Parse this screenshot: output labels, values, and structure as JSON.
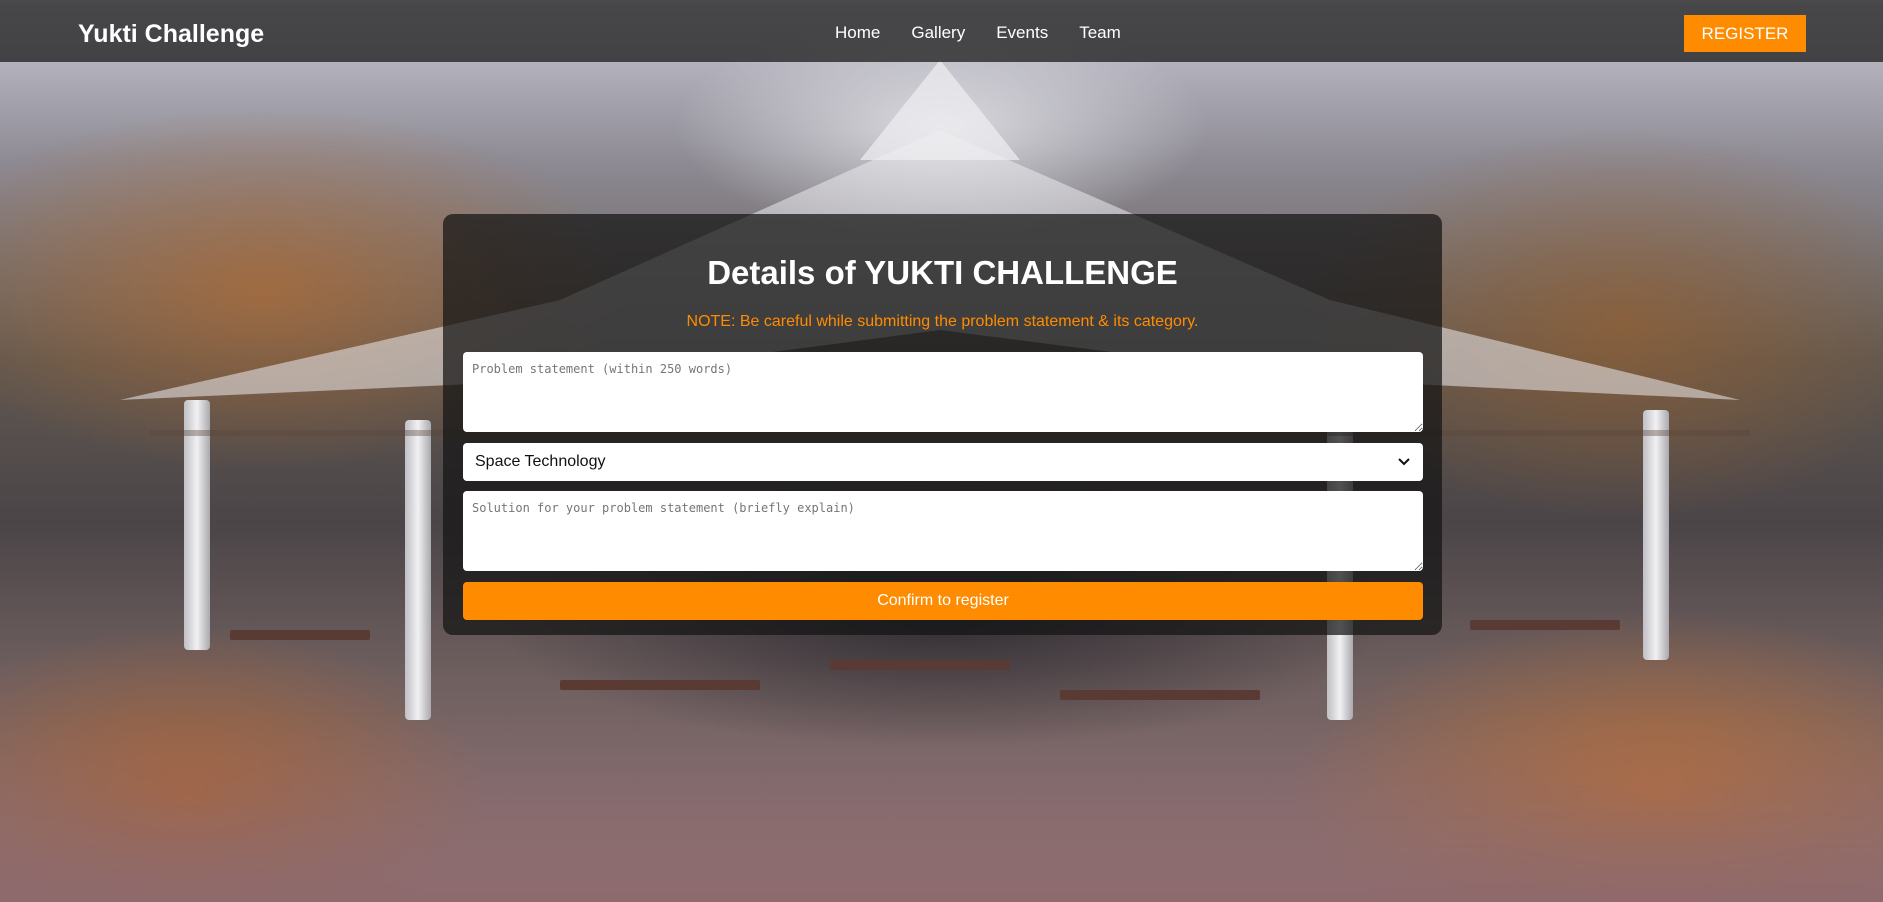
{
  "navbar": {
    "brand": "Yukti Challenge",
    "links": [
      "Home",
      "Gallery",
      "Events",
      "Team"
    ],
    "register_label": "REGISTER"
  },
  "form": {
    "title": "Details of YUKTI CHALLENGE",
    "note": "NOTE: Be careful while submitting the problem statement & its category.",
    "problem_placeholder": "Problem statement (within 250 words)",
    "category_selected": "Space Technology",
    "solution_placeholder": "Solution for your problem statement (briefly explain)",
    "confirm_label": "Confirm to register"
  },
  "colors": {
    "accent": "#ff8c00",
    "navbar_bg": "#232323",
    "card_bg": "#141414"
  },
  "icons": {
    "select_indicator": "chevron-down-icon",
    "textarea_resize": "resize-handle-icon"
  }
}
